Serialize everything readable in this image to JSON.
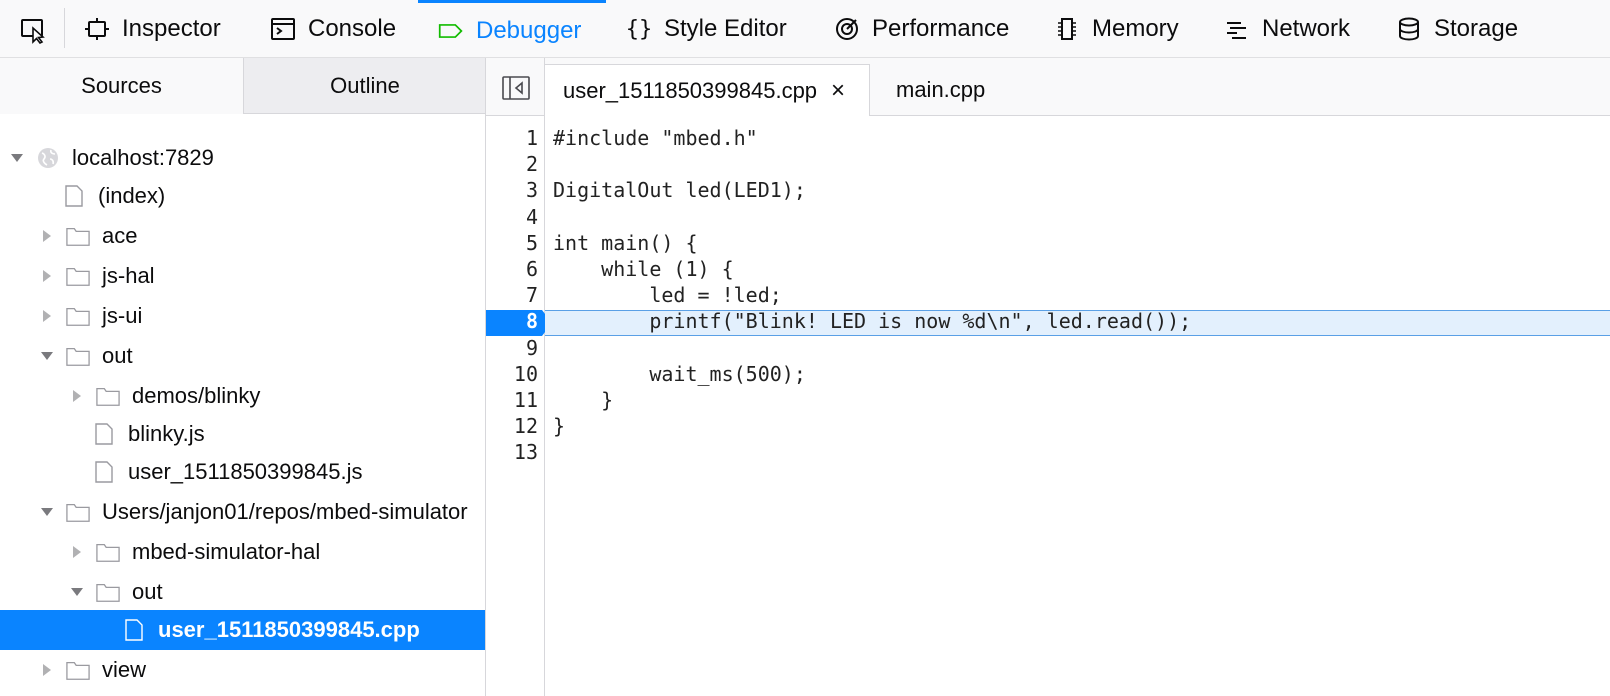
{
  "toolbar": {
    "tabs": [
      {
        "label": "Inspector",
        "icon": "inspector-icon"
      },
      {
        "label": "Console",
        "icon": "console-icon"
      },
      {
        "label": "Debugger",
        "icon": "debugger-icon",
        "selected": true
      },
      {
        "label": "Style Editor",
        "icon": "style-editor-icon"
      },
      {
        "label": "Performance",
        "icon": "performance-icon"
      },
      {
        "label": "Memory",
        "icon": "memory-icon"
      },
      {
        "label": "Network",
        "icon": "network-icon"
      },
      {
        "label": "Storage",
        "icon": "storage-icon"
      }
    ],
    "accent_color": "#0a84ff",
    "debugger_icon_color": "#12bc00"
  },
  "left_pane": {
    "tabs": {
      "sources": "Sources",
      "outline": "Outline"
    },
    "tree": [
      {
        "label": "localhost:7829",
        "kind": "host",
        "expanded": true
      },
      {
        "label": "(index)",
        "kind": "file"
      },
      {
        "label": "ace",
        "kind": "folder",
        "expanded": false
      },
      {
        "label": "js-hal",
        "kind": "folder",
        "expanded": false
      },
      {
        "label": "js-ui",
        "kind": "folder",
        "expanded": false
      },
      {
        "label": "out",
        "kind": "folder",
        "expanded": true
      },
      {
        "label": "demos/blinky",
        "kind": "folder",
        "expanded": false
      },
      {
        "label": "blinky.js",
        "kind": "file"
      },
      {
        "label": "user_1511850399845.js",
        "kind": "file"
      },
      {
        "label": "Users/janjon01/repos/mbed-simulator",
        "kind": "folder",
        "expanded": true
      },
      {
        "label": "mbed-simulator-hal",
        "kind": "folder",
        "expanded": false
      },
      {
        "label": "out",
        "kind": "folder",
        "expanded": true
      },
      {
        "label": "user_1511850399845.cpp",
        "kind": "file",
        "selected": true
      },
      {
        "label": "view",
        "kind": "folder",
        "expanded": false
      }
    ]
  },
  "editor": {
    "tabs": [
      {
        "label": "user_1511850399845.cpp",
        "active": true,
        "close": "×"
      },
      {
        "label": "main.cpp",
        "active": false
      }
    ],
    "breakpoint_line": 8,
    "lines": [
      {
        "n": "1",
        "text": "#include \"mbed.h\""
      },
      {
        "n": "2",
        "text": ""
      },
      {
        "n": "3",
        "text": "DigitalOut led(LED1);"
      },
      {
        "n": "4",
        "text": ""
      },
      {
        "n": "5",
        "text": "int main() {"
      },
      {
        "n": "6",
        "text": "    while (1) {"
      },
      {
        "n": "7",
        "text": "        led = !led;"
      },
      {
        "n": "8",
        "text": "        printf(\"Blink! LED is now %d\\n\", led.read());"
      },
      {
        "n": "9",
        "text": ""
      },
      {
        "n": "10",
        "text": "        wait_ms(500);"
      },
      {
        "n": "11",
        "text": "    }"
      },
      {
        "n": "12",
        "text": "}"
      },
      {
        "n": "13",
        "text": ""
      }
    ]
  }
}
